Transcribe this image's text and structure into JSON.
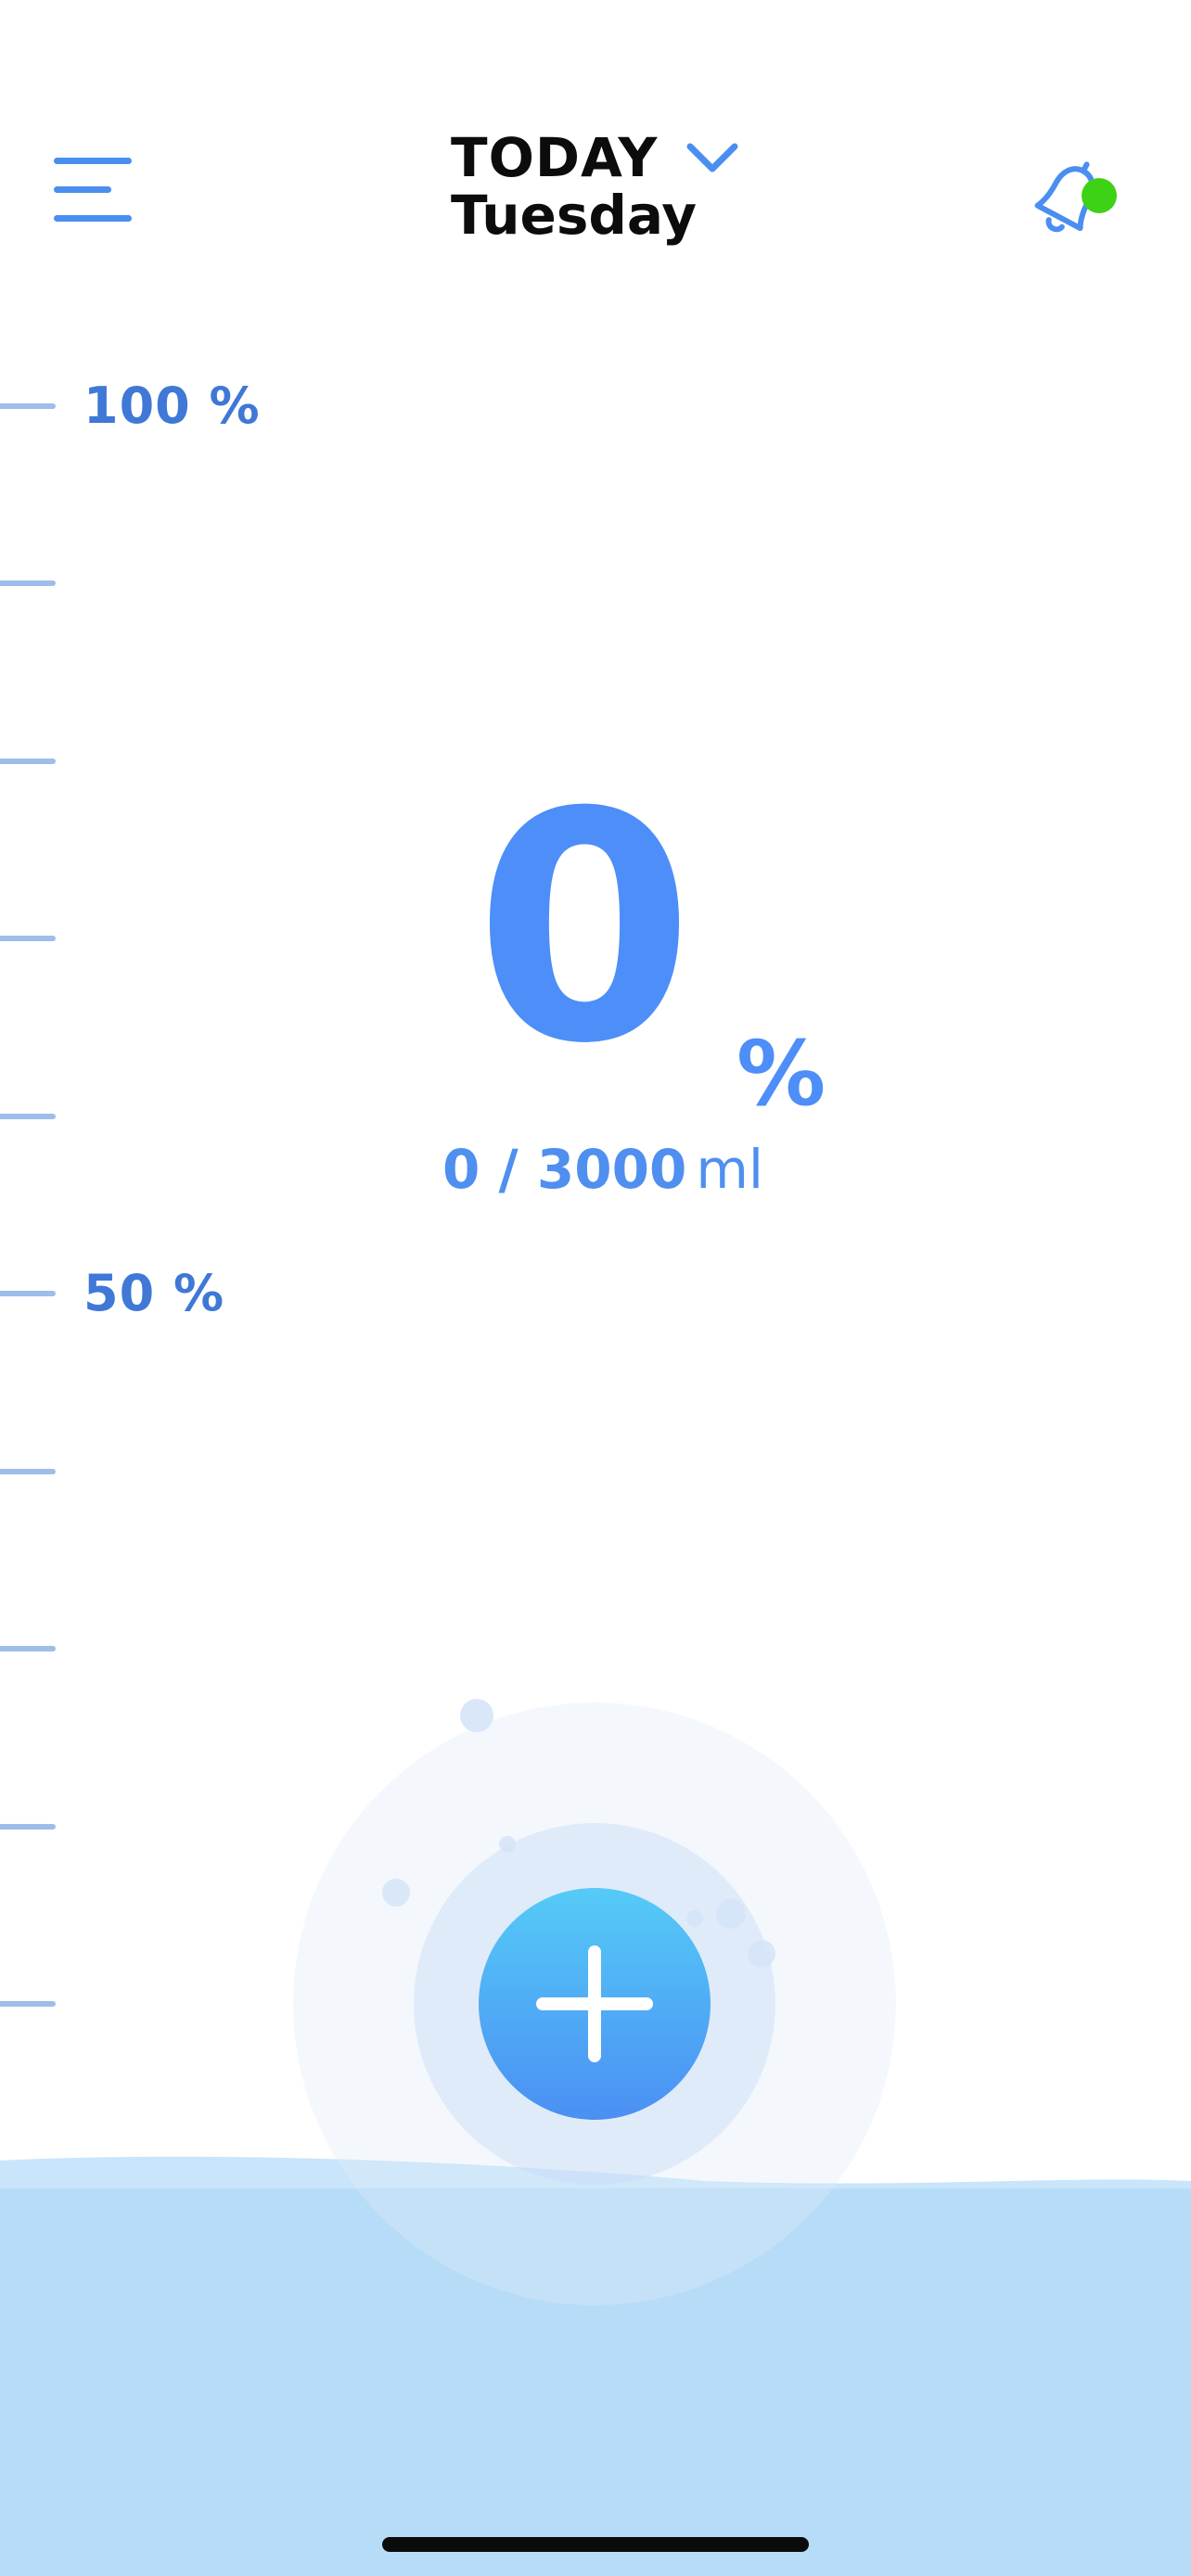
{
  "header": {
    "menu_icon": "hamburger-menu-icon",
    "date_label": "TODAY",
    "day_label": "Tuesday",
    "dropdown_icon": "chevron-down-icon",
    "notification_icon": "bell-icon",
    "notification_indicator_color": "#3dd216"
  },
  "scale": {
    "label_top": "100 %",
    "label_middle": "50 %",
    "tick_count": 11
  },
  "progress": {
    "value": "0",
    "unit": "%",
    "fraction": 0.0,
    "intake": "0 / 3000",
    "intake_unit": "ml"
  },
  "actions": {
    "add_icon": "plus-icon"
  },
  "colors": {
    "accent": "#4d8ef8",
    "water": "#b7dcf8",
    "button_gradient_top": "#55cbf7",
    "button_gradient_bottom": "#4b8ff3"
  }
}
